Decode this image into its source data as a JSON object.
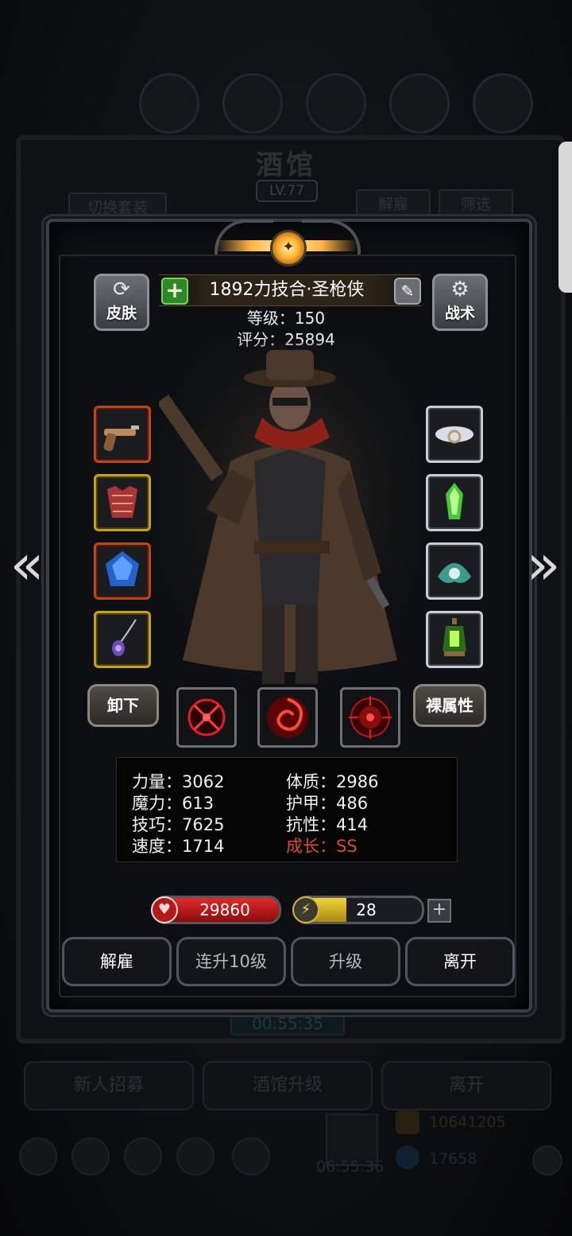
{
  "background": {
    "tavern_title": "酒馆",
    "tavern_level": "LV.77",
    "switch_outfit": "切换套装",
    "dismiss": "解雇",
    "filter": "筛选",
    "timer_small": "00:55:35",
    "bottom_buttons": [
      "新人招募",
      "酒馆升级",
      "离开"
    ],
    "resource_gold": "10641205",
    "resource_gems": "17658",
    "bottom_timer": "06:55:36"
  },
  "hero": {
    "name": "1892力技合·圣枪侠",
    "level_text": "等级：150",
    "score_text": "评分：25894"
  },
  "corner_buttons": {
    "skin": "皮肤",
    "tactics": "战术"
  },
  "equipment": {
    "left_slots": [
      {
        "icon": "pistol-icon",
        "border": "red"
      },
      {
        "icon": "armor-icon",
        "border": "gold"
      },
      {
        "icon": "blue-gem-icon",
        "border": "red"
      },
      {
        "icon": "amulet-icon",
        "border": "gold"
      }
    ],
    "right_slots": [
      {
        "icon": "cloud-ring-icon",
        "border": "silver"
      },
      {
        "icon": "green-crystal-icon",
        "border": "silver"
      },
      {
        "icon": "shell-icon",
        "border": "silver"
      },
      {
        "icon": "lantern-icon",
        "border": "silver"
      }
    ]
  },
  "controls": {
    "unequip": "卸下",
    "base_attributes": "裸属性",
    "skills": [
      "crosshair-skill-icon",
      "vortex-skill-icon",
      "target-skill-icon"
    ]
  },
  "stats": {
    "strength": "力量：3062",
    "magic": "魔力：613",
    "skill": "技巧：7625",
    "speed": "速度：1714",
    "constitution": "体质：2986",
    "armor": "护甲：486",
    "resistance": "抗性：414",
    "growth": "成长：SS"
  },
  "bars": {
    "hp": "29860",
    "energy": "28",
    "energy_fill": 0.4
  },
  "actions": {
    "dismiss": "解雇",
    "level_up_10": "连升10级",
    "level_up": "升级",
    "leave": "离开"
  },
  "colors": {
    "growth": "#e04a2a",
    "hp": "#e02a2a",
    "energy": "#f3d33a"
  }
}
